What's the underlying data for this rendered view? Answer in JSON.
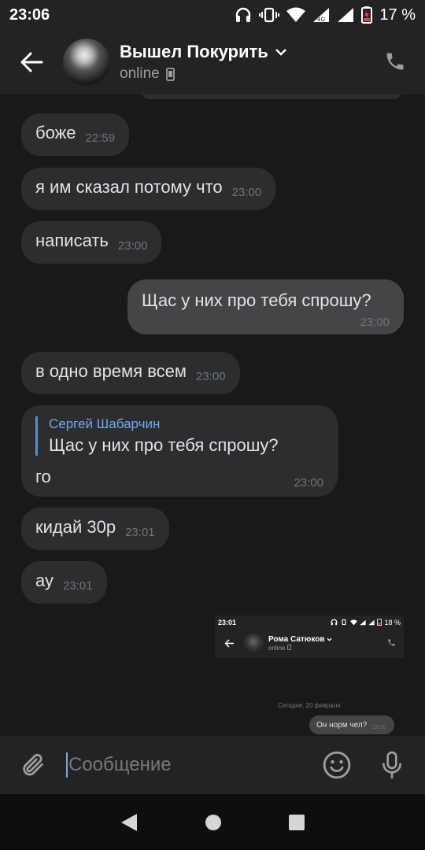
{
  "status_bar": {
    "time": "23:06",
    "battery": "17 %"
  },
  "header": {
    "title": "Вышел Покурить",
    "status": "online"
  },
  "messages": [
    {
      "text": "боже",
      "time": "22:59"
    },
    {
      "text": "я им сказал потому что",
      "time": "23:00"
    },
    {
      "text": "написать",
      "time": "23:00"
    },
    {
      "text": "Щас у них про тебя спрошу?",
      "time": "23:00",
      "outgoing": true
    },
    {
      "text": "в одно время всем",
      "time": "23:00"
    },
    {
      "reply_author": "Сергей Шабарчин",
      "reply_text": "Щас у них про тебя спрошу?",
      "text": "го",
      "time": "23:00"
    },
    {
      "text": "кидай 30р",
      "time": "23:01"
    },
    {
      "text": "ау",
      "time": "23:01"
    }
  ],
  "screenshot": {
    "time": "23:01",
    "battery": "18 %",
    "title": "Рома Сатюков",
    "status": "online",
    "date": "Сегодня, 20 февраля",
    "message": "Он норм чел?",
    "message_time": "23:01"
  },
  "composer": {
    "placeholder": "Сообщение"
  },
  "colors": {
    "background": "#191919",
    "bar": "#232323",
    "bubble": "#2c2d2e",
    "bubble_out": "#444547",
    "accent": "#71aaeb"
  },
  "icons": [
    "back-arrow-icon",
    "chevron-down-icon",
    "phone-icon",
    "paperclip-icon",
    "smile-icon",
    "microphone-icon",
    "headphones-icon",
    "vibrate-icon",
    "wifi-icon",
    "signal-icon",
    "battery-icon",
    "nav-back-icon",
    "nav-home-icon",
    "nav-recents-icon"
  ]
}
